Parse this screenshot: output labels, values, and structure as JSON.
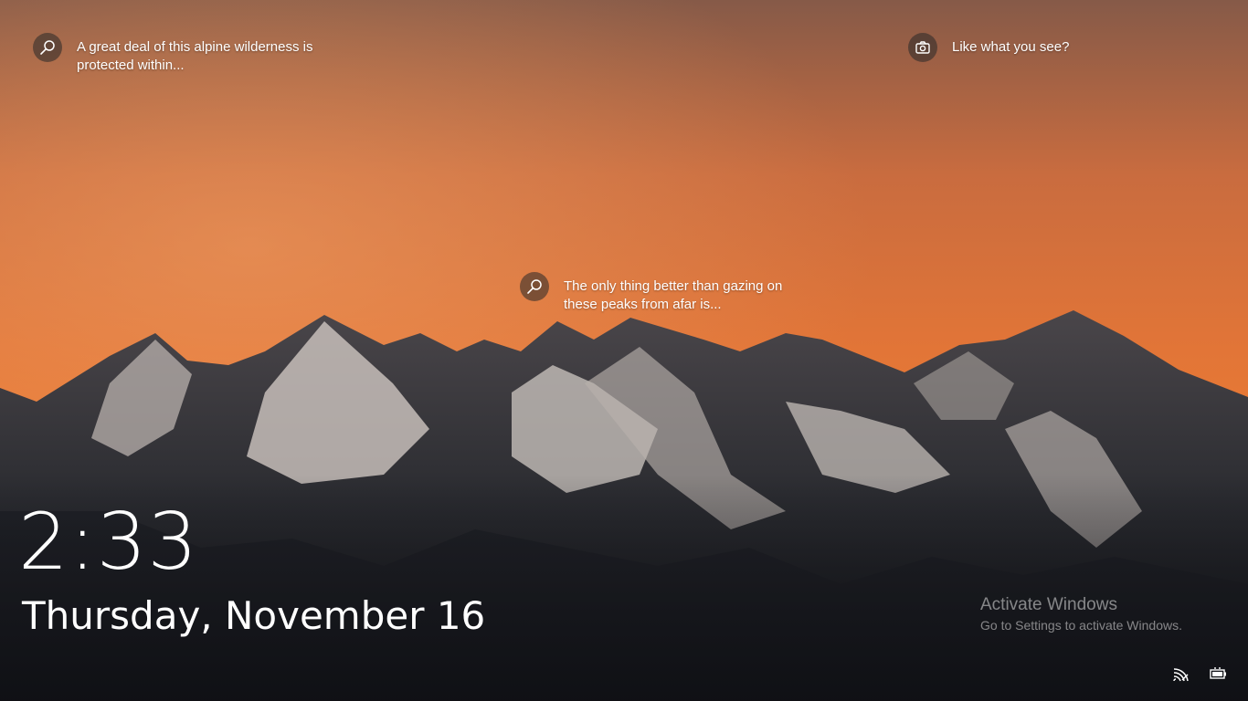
{
  "lock_screen": {
    "hints": {
      "top_left": {
        "icon": "search-icon",
        "text": "A great deal of this alpine wilderness is protected within..."
      },
      "top_right": {
        "icon": "camera-icon",
        "text": "Like what you see?"
      },
      "center": {
        "icon": "search-icon",
        "text": "The only thing better than gazing on these peaks from afar is..."
      }
    },
    "clock": {
      "time": "2:33",
      "date": "Thursday, November 16"
    },
    "watermark": {
      "title": "Activate Windows",
      "subtitle": "Go to Settings to activate Windows."
    },
    "tray": {
      "network_icon": "network-icon",
      "battery_icon": "battery-icon"
    },
    "colors": {
      "sky_top": "#8d5a45",
      "sky_mid": "#e4783a",
      "mountain_dark": "#1b1d22",
      "snow": "#cfc9c5"
    }
  }
}
